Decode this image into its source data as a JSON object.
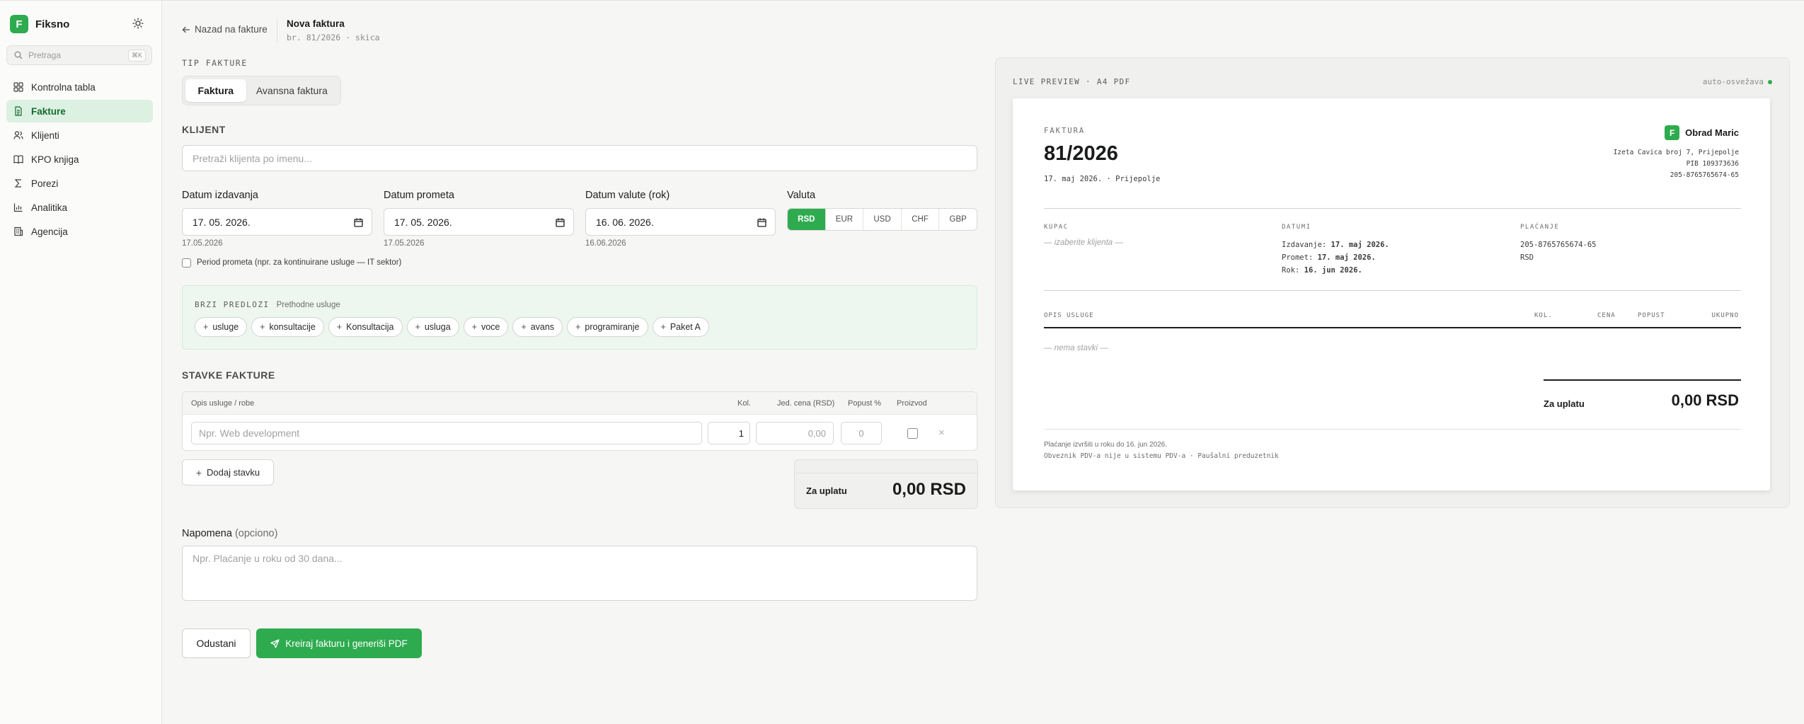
{
  "app": {
    "name": "Fiksno",
    "logo_letter": "F",
    "accent": "#2eab4f"
  },
  "sidebar": {
    "search_placeholder": "Pretraga",
    "search_shortcut": "⌘K",
    "items": [
      {
        "label": "Kontrolna tabla",
        "icon": "dashboard-icon"
      },
      {
        "label": "Fakture",
        "icon": "invoice-icon",
        "active": true
      },
      {
        "label": "Klijenti",
        "icon": "users-icon"
      },
      {
        "label": "KPO knjiga",
        "icon": "book-icon"
      },
      {
        "label": "Porezi",
        "icon": "sigma-icon"
      },
      {
        "label": "Analitika",
        "icon": "chart-icon"
      },
      {
        "label": "Agencija",
        "icon": "building-icon"
      }
    ]
  },
  "header": {
    "back_label": "Nazad na fakture",
    "title": "Nova faktura",
    "subtitle": "br. 81/2026 · skica"
  },
  "form": {
    "invoice_type_label": "TIP FAKTURE",
    "tabs": [
      "Faktura",
      "Avansna faktura"
    ],
    "client_section": "KLIJENT",
    "client_placeholder": "Pretraži klijenta po imenu...",
    "issue_date": {
      "label": "Datum izdavanja",
      "value": "17. 05. 2026.",
      "helper": "17.05.2026"
    },
    "service_date": {
      "label": "Datum prometa",
      "value": "17. 05. 2026.",
      "helper": "17.05.2026"
    },
    "due_date": {
      "label": "Datum valute (rok)",
      "value": "16. 06. 2026.",
      "helper": "16.06.2026"
    },
    "currency": {
      "label": "Valuta",
      "options": [
        "RSD",
        "EUR",
        "USD",
        "CHF",
        "GBP"
      ],
      "selected": "RSD"
    },
    "period_checkbox_label": "Period prometa (npr. za kontinuirane usluge — IT sektor)",
    "quick": {
      "title": "BRZI PREDLOZI",
      "subtitle": "Prethodne usluge",
      "chips": [
        "usluge",
        "konsultacije",
        "Konsultacija",
        "usluga",
        "voce",
        "avans",
        "programiranje",
        "Paket A"
      ]
    },
    "items_section": "STAVKE FAKTURE",
    "items_headers": {
      "desc": "Opis usluge / robe",
      "qty": "Kol.",
      "price": "Jed. cena (RSD)",
      "discount": "Popust %",
      "product": "Proizvod"
    },
    "item_row": {
      "desc_placeholder": "Npr. Web development",
      "qty": "1",
      "price_placeholder": "0,00",
      "discount_placeholder": "0",
      "remove": "×"
    },
    "add_item_label": "Dodaj stavku",
    "total_label": "Za uplatu",
    "total_value": "0,00 RSD",
    "note_label": "Napomena",
    "note_optional": "(opciono)",
    "note_placeholder": "Npr. Plaćanje u roku od 30 dana...",
    "cancel_label": "Odustani",
    "submit_label": "Kreiraj fakturu i generiši PDF"
  },
  "preview": {
    "title": "LIVE PREVIEW · A4 PDF",
    "auto": "auto-osvežava",
    "doc": {
      "kind": "FAKTURA",
      "number": "81/2026",
      "date_place": "17. maj 2026. · Prijepolje",
      "issuer_logo": "F",
      "issuer_name": "Obrad Maric",
      "issuer_address": "Izeta Cavica broj 7, Prijepolje",
      "issuer_pib": "PIB 109373636",
      "issuer_account": "205-8765765674-65",
      "buyer_label": "KUPAC",
      "buyer_empty": "— izaberite klijenta —",
      "dates_label": "DATUMI",
      "issued_key": "Izdavanje:",
      "issued_val": "17. maj 2026.",
      "service_key": "Promet:",
      "service_val": "17. maj 2026.",
      "due_key": "Rok:",
      "due_val": "16. jun 2026.",
      "payment_label": "PLAĆANJE",
      "payment_account": "205-8765765674-65",
      "payment_currency": "RSD",
      "col_desc": "OPIS USLUGE",
      "col_qty": "KOL.",
      "col_price": "CENA",
      "col_discount": "POPUST",
      "col_total": "UKUPNO",
      "no_items": "— nema stavki —",
      "total_label": "Za uplatu",
      "total_value": "0,00 RSD",
      "footer_1": "Plaćanje izvršiti u roku do 16. jun 2026.",
      "footer_2": "Obveznik PDV-a nije u sistemu PDV-a · Paušalni preduzetnik"
    }
  }
}
